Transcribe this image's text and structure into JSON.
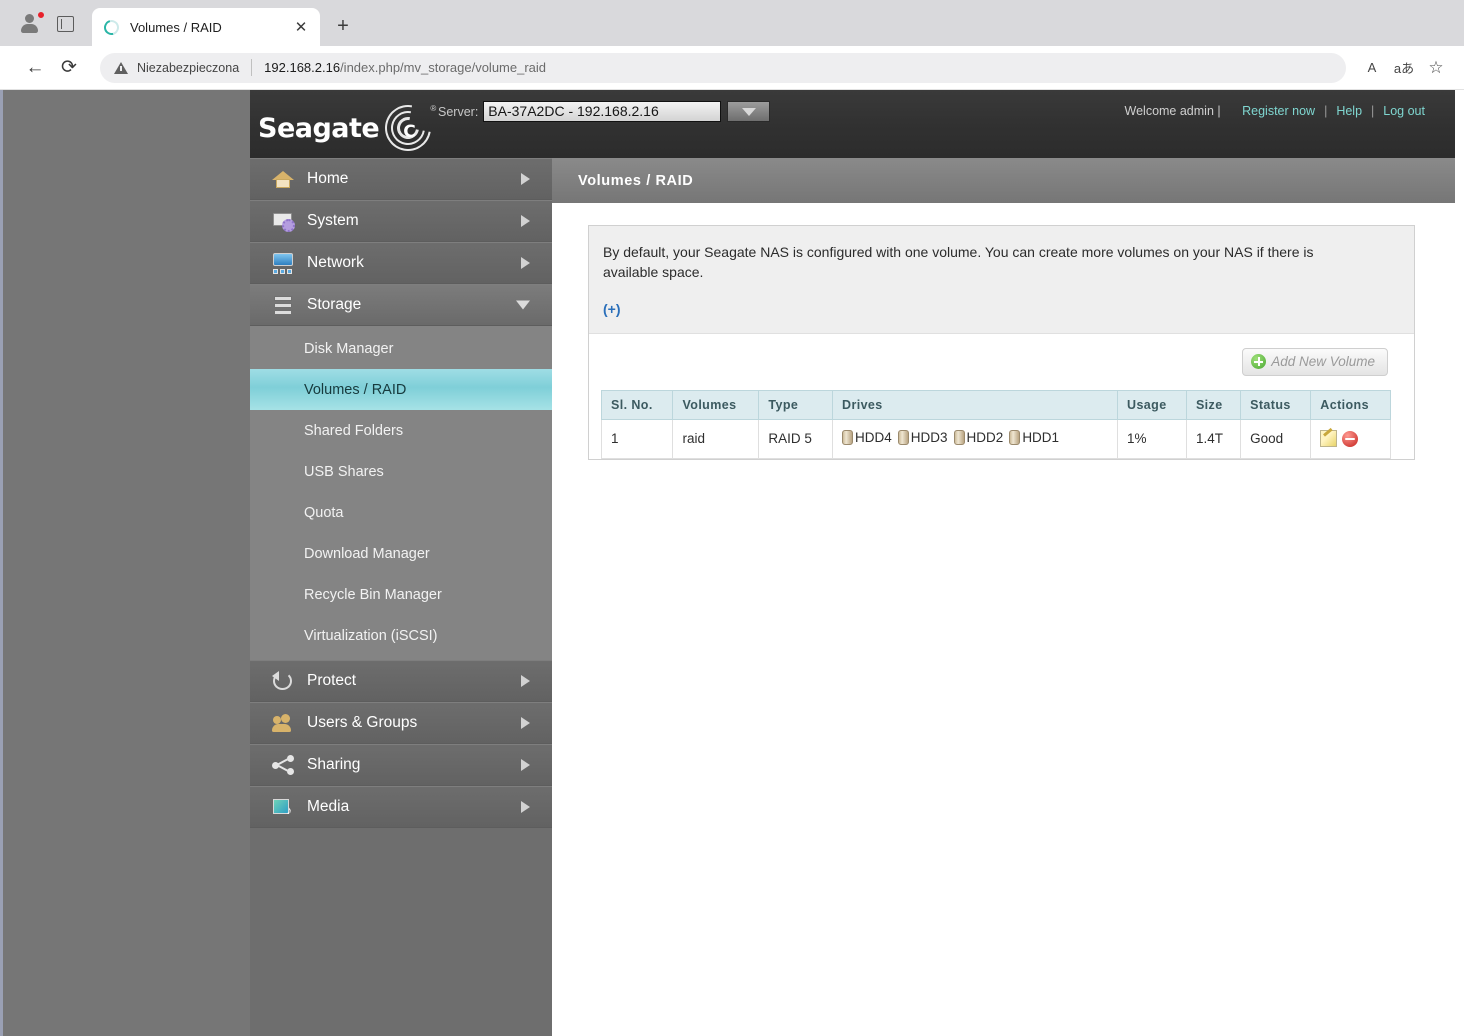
{
  "browser": {
    "tab_title": "Volumes / RAID",
    "close_label": "✕",
    "newtab_label": "+",
    "back_label": "←",
    "reload_label": "⟳",
    "security_text": "Niezabezpieczona",
    "url_host": "192.168.2.16",
    "url_path": "/index.php/mv_storage/volume_raid",
    "read_aloud_label": "A",
    "translate_label": "aあ",
    "favorite_label": "☆"
  },
  "header": {
    "brand": "Seagate",
    "brand_mark_letter": "C",
    "brand_registered": "®",
    "server_label": "Server:",
    "server_value": "BA-37A2DC - 192.168.2.16",
    "dropdown_arrow": "▼",
    "welcome": "Welcome admin |",
    "links": [
      {
        "label": "Register now"
      },
      {
        "label": "Help"
      },
      {
        "label": "Log out"
      }
    ],
    "separator": "|"
  },
  "sidebar": {
    "items": [
      {
        "label": "Home",
        "icon": "home-icon",
        "caret": "right"
      },
      {
        "label": "System",
        "icon": "system-gear-icon",
        "caret": "right"
      },
      {
        "label": "Network",
        "icon": "network-icon",
        "caret": "right"
      },
      {
        "label": "Storage",
        "icon": "storage-icon",
        "caret": "down",
        "expanded": true
      },
      {
        "label": "Protect",
        "icon": "protect-icon",
        "caret": "right"
      },
      {
        "label": "Users & Groups",
        "icon": "users-icon",
        "caret": "right"
      },
      {
        "label": "Sharing",
        "icon": "sharing-icon",
        "caret": "right"
      },
      {
        "label": "Media",
        "icon": "media-icon",
        "caret": "right"
      }
    ],
    "storage_submenu": [
      {
        "label": "Disk Manager",
        "active": false
      },
      {
        "label": "Volumes / RAID",
        "active": true
      },
      {
        "label": "Shared Folders",
        "active": false
      },
      {
        "label": "USB Shares",
        "active": false
      },
      {
        "label": "Quota",
        "active": false
      },
      {
        "label": "Download Manager",
        "active": false
      },
      {
        "label": "Recycle Bin Manager",
        "active": false
      },
      {
        "label": "Virtualization (iSCSI)",
        "active": false
      }
    ]
  },
  "main": {
    "page_title": "Volumes / RAID",
    "notice": "By default, your Seagate NAS is configured with one volume. You can create more volumes on your NAS if there is available space.",
    "expand_toggle": "(+)",
    "add_button_label": "Add New Volume",
    "table": {
      "columns": [
        "Sl. No.",
        "Volumes",
        "Type",
        "Drives",
        "Usage",
        "Size",
        "Status",
        "Actions"
      ],
      "rows": [
        {
          "sl_no": "1",
          "volume": "raid",
          "type": "RAID 5",
          "drives": [
            "HDD4",
            "HDD3",
            "HDD2",
            "HDD1"
          ],
          "usage": "1%",
          "size": "1.4T",
          "status": "Good",
          "actions": [
            "edit-icon",
            "delete-icon"
          ]
        }
      ]
    }
  },
  "colors": {
    "accent_teal": "#7fd6d0",
    "highlight": "#7fcfd8",
    "link_blue": "#2a6fba",
    "header_dark": "#313131",
    "sidebar_gray": "#6e6e6e"
  }
}
